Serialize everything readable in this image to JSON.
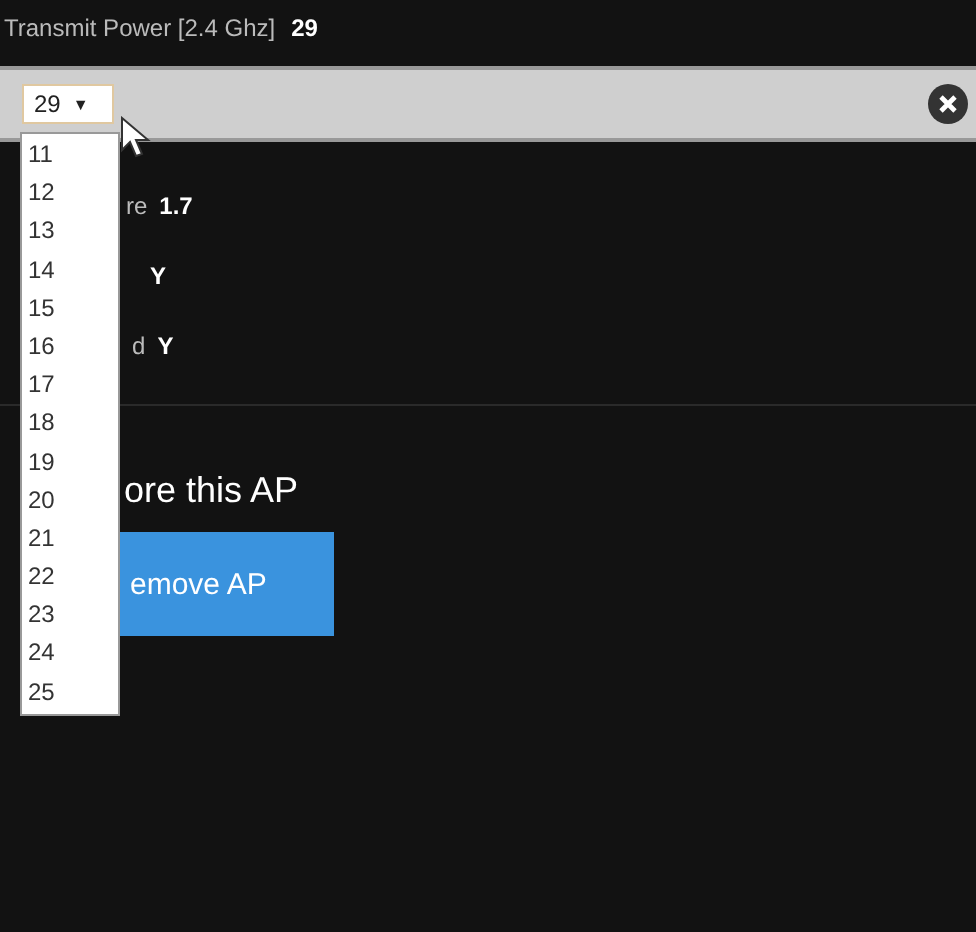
{
  "header": {
    "label": "Transmit Power [2.4 Ghz]",
    "value": "29"
  },
  "select": {
    "value": "29",
    "arrow": "▼",
    "options": [
      "11",
      "12",
      "13",
      "14",
      "15",
      "16",
      "17",
      "18",
      "19",
      "20",
      "21",
      "22",
      "23",
      "24",
      "25"
    ]
  },
  "rows": [
    {
      "label": "re",
      "value": "1.7"
    },
    {
      "value": "Y"
    },
    {
      "label": "d",
      "value": "Y"
    }
  ],
  "section_title": "ore this AP",
  "button": "emove AP"
}
